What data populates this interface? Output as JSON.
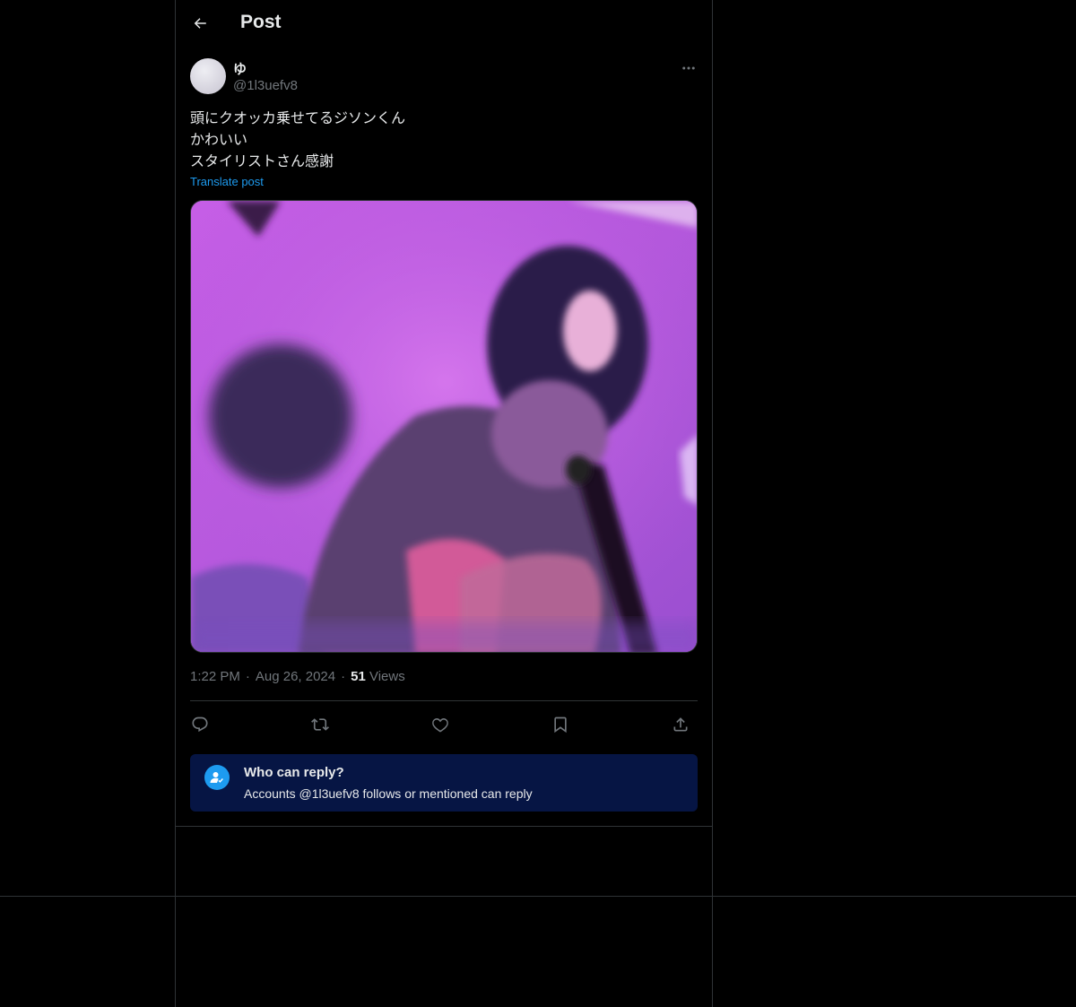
{
  "header": {
    "title": "Post",
    "back_icon": "arrow-left-icon"
  },
  "author": {
    "display_name": "ゆ",
    "handle": "@1l3uefv8"
  },
  "post": {
    "lines": [
      "頭にクオッカ乗せてるジソンくん",
      "かわいい",
      "スタイリストさん感謝"
    ],
    "translate_label": "Translate post",
    "time": "1:22 PM",
    "date": "Aug 26, 2024",
    "views_count": "51",
    "views_label": "Views",
    "separator": "·"
  },
  "actions": {
    "icons": [
      "reply-icon",
      "repost-icon",
      "like-icon",
      "bookmark-icon",
      "share-icon"
    ]
  },
  "reply_settings": {
    "title": "Who can reply?",
    "description": "Accounts @1l3uefv8 follows or mentioned can reply"
  },
  "colors": {
    "background": "#000000",
    "text_primary": "#e7e9ea",
    "text_secondary": "#71767b",
    "accent": "#1d9bf0",
    "reply_box_bg": "#061544",
    "border": "#2f3336"
  }
}
